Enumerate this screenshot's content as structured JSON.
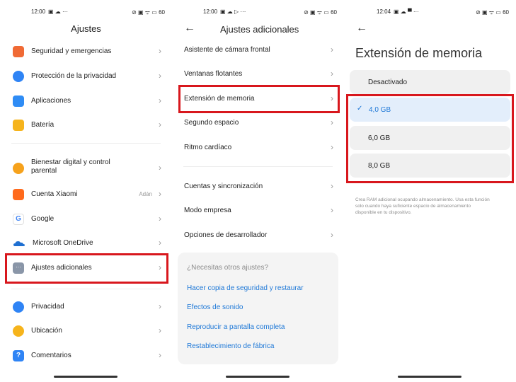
{
  "screen1": {
    "status": {
      "time": "12:00",
      "indicators": "▣ ☁ ···",
      "right": "⊘ ▣ ᯤ ▭ 60"
    },
    "title": "Ajustes",
    "items": [
      {
        "label": "Seguridad y emergencias",
        "icon": "shield-orange-icon",
        "color": "#f06a35"
      },
      {
        "label": "Protección de la privacidad",
        "icon": "privacy-blue-icon",
        "color": "#2f84f5"
      },
      {
        "label": "Aplicaciones",
        "icon": "apps-blue-icon",
        "color": "#2f8cf5"
      },
      {
        "label": "Batería",
        "icon": "battery-yellow-icon",
        "color": "#f6b41c"
      },
      {
        "label": "Bienestar digital y control parental",
        "icon": "wellbeing-yellow-icon",
        "color": "#f6a21c"
      },
      {
        "label": "Cuenta Xiaomi",
        "value": "Adán",
        "icon": "xiaomi-orange-icon",
        "color": "#ff6a1c"
      },
      {
        "label": "Google",
        "icon": "google-icon",
        "color": "#ffffff"
      },
      {
        "label": "Microsoft OneDrive",
        "icon": "onedrive-icon",
        "color": "#1e6fd1"
      },
      {
        "label": "Ajustes adicionales",
        "icon": "more-gray-icon",
        "color": "#8a96a8"
      },
      {
        "label": "Privacidad",
        "icon": "eye-blue-icon",
        "color": "#2f84f5"
      },
      {
        "label": "Ubicación",
        "icon": "location-yellow-icon",
        "color": "#f6b41c"
      },
      {
        "label": "Comentarios",
        "icon": "feedback-blue-icon",
        "color": "#2f84f5"
      }
    ]
  },
  "screen2": {
    "status": {
      "time": "12:00",
      "indicators": "▣ ☁ ▷ ···",
      "right": "⊘ ▣ ᯤ ▭ 60"
    },
    "title": "Ajustes adicionales",
    "items": [
      "Asistente de cámara frontal",
      "Ventanas flotantes",
      "Extensión de memoria",
      "Segundo espacio",
      "Ritmo cardíaco",
      "Cuentas y sincronización",
      "Modo empresa",
      "Opciones de desarrollador"
    ],
    "card": {
      "question": "¿Necesitas otros ajustes?",
      "links": [
        "Hacer copia de seguridad y restaurar",
        "Efectos de sonido",
        "Reproducir a pantalla completa",
        "Restablecimiento de fábrica"
      ]
    }
  },
  "screen3": {
    "status": {
      "time": "12:04",
      "indicators": "▣ ☁ ▀ ···",
      "right": "⊘ ▣ ᯤ ▭ 60"
    },
    "title": "Extensión de memoria",
    "options": [
      "Desactivado",
      "4,0 GB",
      "6,0 GB",
      "8,0 GB"
    ],
    "selected_index": 1,
    "note": "Crea RAM adicional ocupando almacenamiento. Usa esta función solo cuando haya suficiente espacio de almacenamiento disponible en tu dispositivo."
  },
  "colors": {
    "accent": "#1e78d7",
    "highlight": "#d8171d"
  }
}
